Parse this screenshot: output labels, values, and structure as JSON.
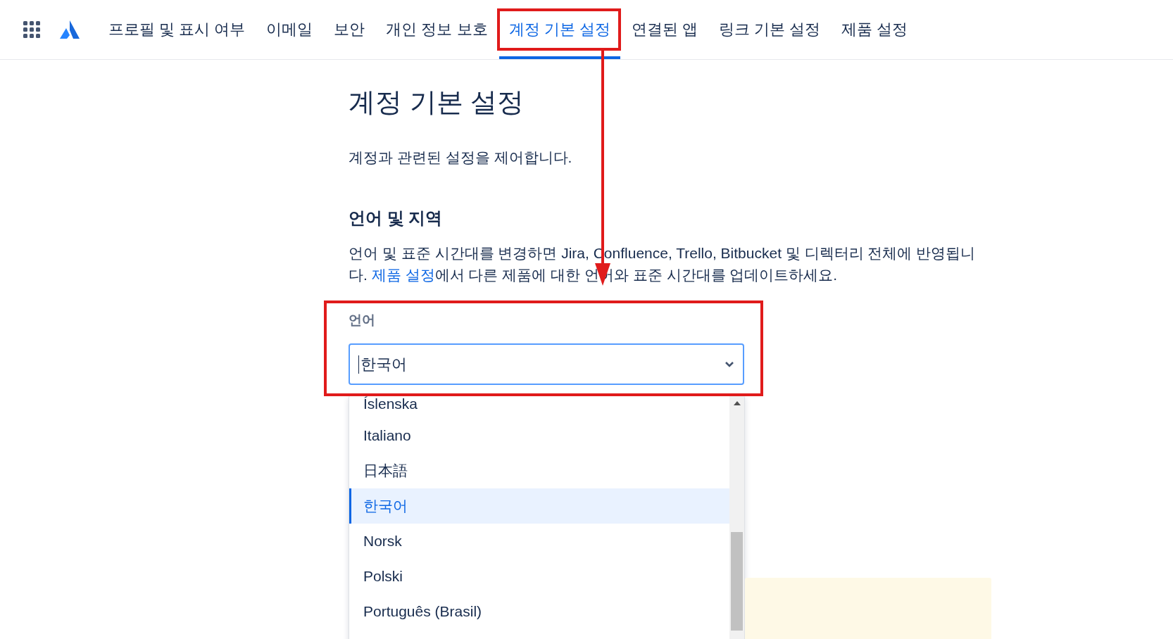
{
  "nav": {
    "tabs": [
      {
        "label": "프로필 및 표시 여부",
        "selected": false
      },
      {
        "label": "이메일",
        "selected": false
      },
      {
        "label": "보안",
        "selected": false
      },
      {
        "label": "개인 정보 보호",
        "selected": false
      },
      {
        "label": "계정 기본 설정",
        "selected": true
      },
      {
        "label": "연결된 앱",
        "selected": false
      },
      {
        "label": "링크 기본 설정",
        "selected": false
      },
      {
        "label": "제품 설정",
        "selected": false
      }
    ]
  },
  "page": {
    "title": "계정 기본 설정",
    "description": "계정과 관련된 설정을 제어합니다."
  },
  "section": {
    "heading": "언어 및 지역",
    "text_before": "언어 및 표준 시간대를 변경하면 Jira, Confluence, Trello, Bitbucket 및 디렉터리 전체에 반영됩니다. ",
    "link": "제품 설정",
    "text_after": "에서 다른 제품에 대한 언어와 표준 시간대를 업데이트하세요."
  },
  "language": {
    "label": "언어",
    "value": "한국어",
    "options": [
      {
        "label": "Íslenska",
        "selected": false
      },
      {
        "label": "Italiano",
        "selected": false
      },
      {
        "label": "日本語",
        "selected": false
      },
      {
        "label": "한국어",
        "selected": true
      },
      {
        "label": "Norsk",
        "selected": false
      },
      {
        "label": "Polski",
        "selected": false
      },
      {
        "label": "Português (Brasil)",
        "selected": false
      }
    ]
  }
}
